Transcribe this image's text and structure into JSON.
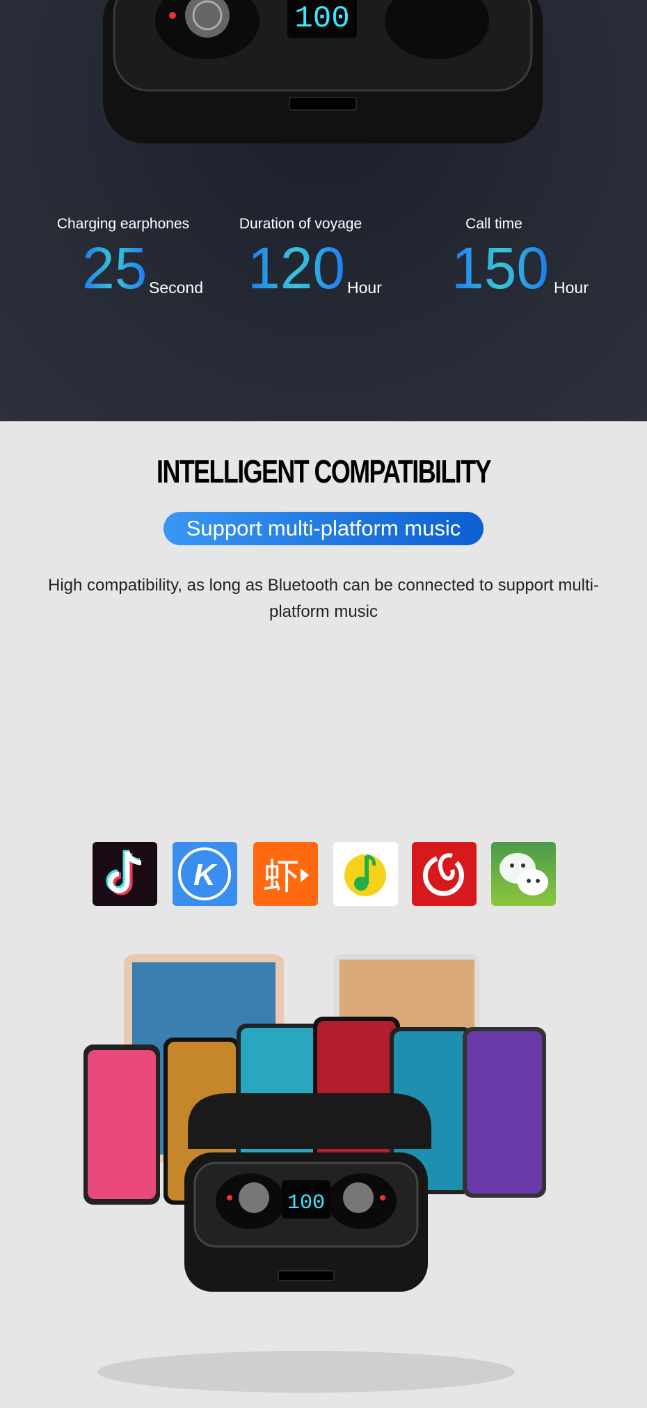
{
  "stats": [
    {
      "label": "Charging earphones",
      "value": "25",
      "unit": "Second"
    },
    {
      "label": "Duration of voyage",
      "value": "120",
      "unit": "Hour"
    },
    {
      "label": "Call time",
      "value": "150",
      "unit": "Hour"
    }
  ],
  "case_display": "100",
  "section": {
    "title": "INTELLIGENT COMPATIBILITY",
    "badge": "Support multi-platform music",
    "description": "High compatibility, as long as Bluetooth can be connected to support multi-platform music"
  },
  "apps": [
    {
      "icon": "tiktok-icon",
      "color": "#1a0a14"
    },
    {
      "icon": "kugou-icon",
      "color": "#3a8ef0",
      "letter": "K"
    },
    {
      "icon": "xiami-icon",
      "color": "#ff6a10",
      "letter": "虾"
    },
    {
      "icon": "qq-music-icon",
      "color": "#ffffff"
    },
    {
      "icon": "netease-music-icon",
      "color": "#d8191c"
    },
    {
      "icon": "wechat-icon",
      "color": "#5bb13c"
    }
  ],
  "colors": {
    "dark_bg": "#262a35",
    "light_bg": "#e6e6e6",
    "accent": "#1e7bf0"
  }
}
